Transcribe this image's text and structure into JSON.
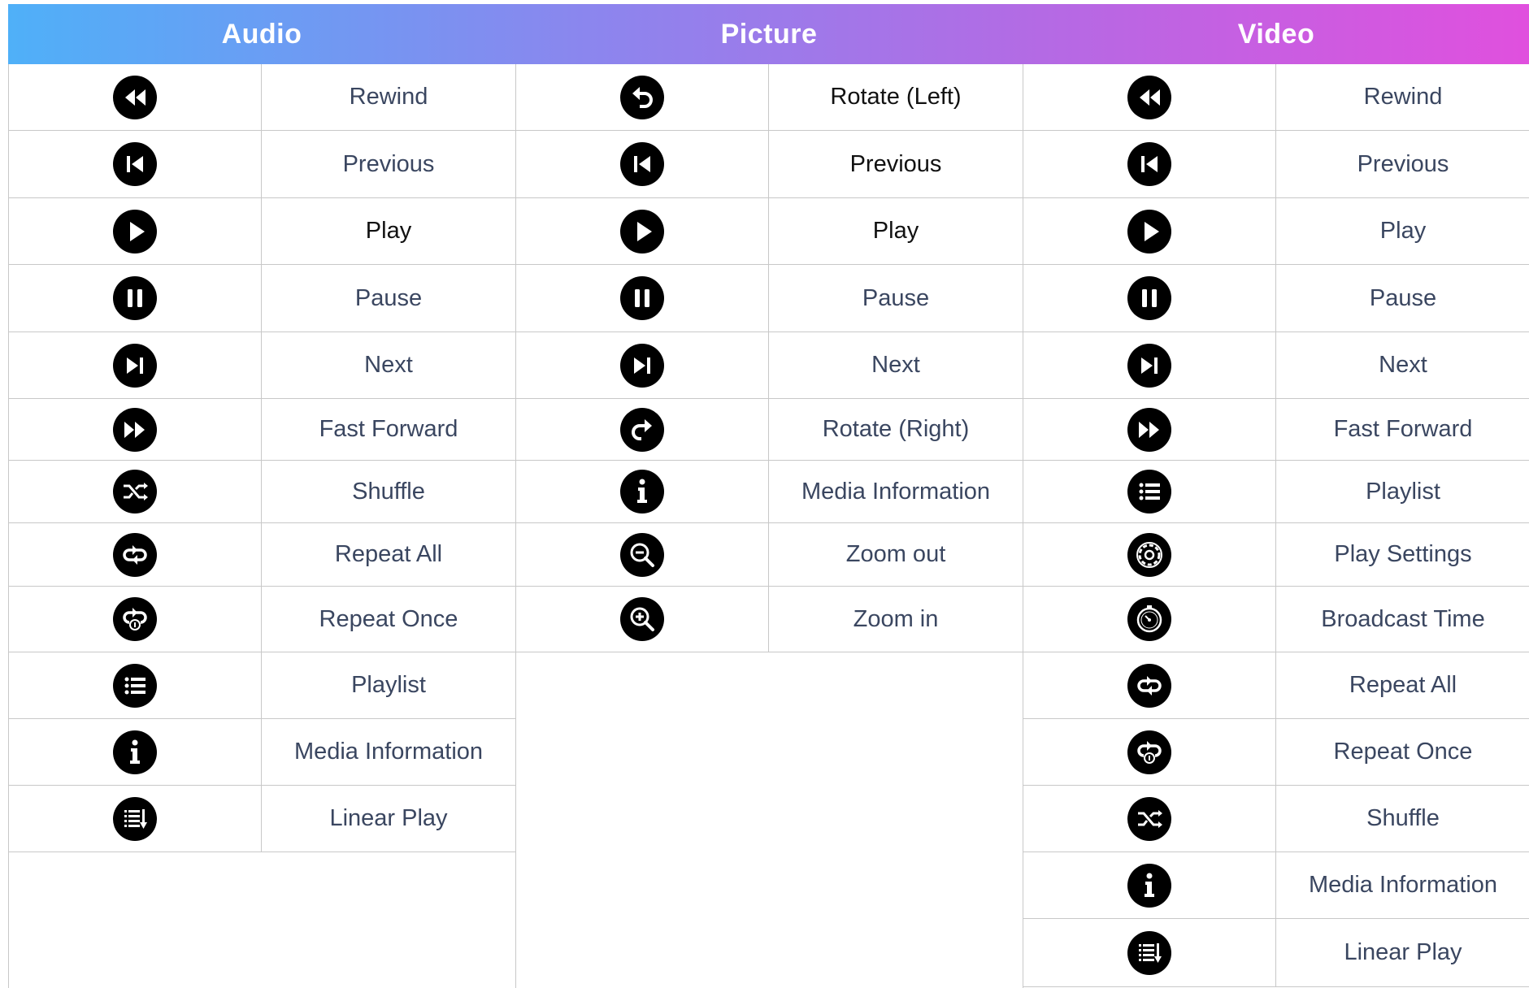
{
  "header": [
    "Audio",
    "Picture",
    "Video"
  ],
  "columns": [
    {
      "name": "audio",
      "rows": [
        {
          "icon": "rewind-icon",
          "label": "Rewind"
        },
        {
          "icon": "previous-icon",
          "label": "Previous"
        },
        {
          "icon": "play-icon",
          "label": "Play"
        },
        {
          "icon": "pause-icon",
          "label": "Pause"
        },
        {
          "icon": "next-icon",
          "label": "Next"
        },
        {
          "icon": "fast-forward-icon",
          "label": "Fast Forward"
        },
        {
          "icon": "shuffle-icon",
          "label": "Shuffle"
        },
        {
          "icon": "repeat-all-icon",
          "label": "Repeat All"
        },
        {
          "icon": "repeat-once-icon",
          "label": "Repeat Once"
        },
        {
          "icon": "playlist-icon",
          "label": "Playlist"
        },
        {
          "icon": "info-icon",
          "label": "Media Information"
        },
        {
          "icon": "linear-play-icon",
          "label": "Linear Play"
        }
      ]
    },
    {
      "name": "picture",
      "rows": [
        {
          "icon": "rotate-left-icon",
          "label": "Rotate (Left)"
        },
        {
          "icon": "previous-icon",
          "label": "Previous"
        },
        {
          "icon": "play-icon",
          "label": "Play"
        },
        {
          "icon": "pause-icon",
          "label": "Pause"
        },
        {
          "icon": "next-icon",
          "label": "Next"
        },
        {
          "icon": "rotate-right-icon",
          "label": "Rotate (Right)"
        },
        {
          "icon": "info-icon",
          "label": "Media Information"
        },
        {
          "icon": "zoom-out-icon",
          "label": "Zoom out"
        },
        {
          "icon": "zoom-in-icon",
          "label": "Zoom in"
        }
      ]
    },
    {
      "name": "video",
      "rows": [
        {
          "icon": "rewind-icon",
          "label": "Rewind"
        },
        {
          "icon": "previous-icon",
          "label": "Previous"
        },
        {
          "icon": "play-icon",
          "label": "Play"
        },
        {
          "icon": "pause-icon",
          "label": "Pause"
        },
        {
          "icon": "next-icon",
          "label": "Next"
        },
        {
          "icon": "fast-forward-icon",
          "label": "Fast Forward"
        },
        {
          "icon": "playlist-icon",
          "label": "Playlist"
        },
        {
          "icon": "play-settings-icon",
          "label": "Play Settings"
        },
        {
          "icon": "broadcast-time-icon",
          "label": "Broadcast Time"
        },
        {
          "icon": "repeat-all-icon",
          "label": "Repeat All"
        },
        {
          "icon": "repeat-once-icon",
          "label": "Repeat Once"
        },
        {
          "icon": "shuffle-icon",
          "label": "Shuffle"
        },
        {
          "icon": "info-icon",
          "label": "Media Information"
        },
        {
          "icon": "linear-play-icon",
          "label": "Linear Play"
        }
      ]
    }
  ]
}
